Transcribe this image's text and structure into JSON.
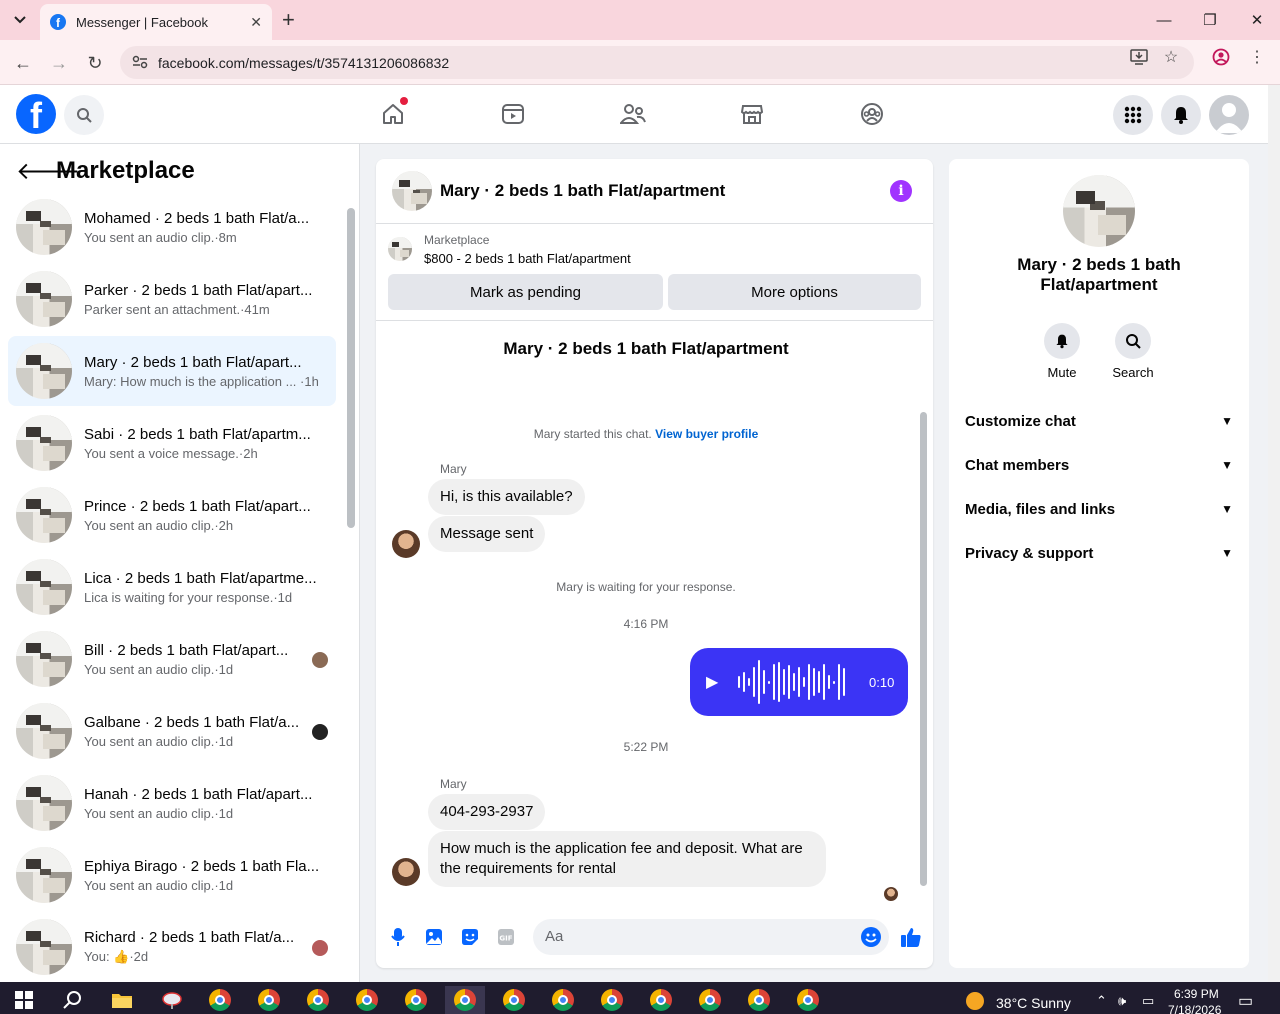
{
  "browser": {
    "tab_title": "Messenger | Facebook",
    "url": "facebook.com/messages/t/3574131206086832"
  },
  "left": {
    "title": "Marketplace",
    "conversations": [
      {
        "name": "Mohamed · 2 beds 1 bath Flat/a...",
        "preview": "You sent an audio clip.·8m"
      },
      {
        "name": "Parker · 2 beds 1 bath Flat/apart...",
        "preview": "Parker sent an attachment.·41m"
      },
      {
        "name": "Mary · 2 beds 1 bath Flat/apart...",
        "preview": "Mary: How much is the application ... ·1h"
      },
      {
        "name": "Sabi · 2 beds 1 bath Flat/apartm...",
        "preview": "You sent a voice message.·2h"
      },
      {
        "name": "Prince · 2 beds 1 bath Flat/apart...",
        "preview": "You sent an audio clip.·2h"
      },
      {
        "name": "Lica · 2 beds 1 bath Flat/apartme...",
        "preview": "Lica is waiting for your response.·1d"
      },
      {
        "name": "Bill · 2 beds 1 bath Flat/apart...",
        "preview": "You sent an audio clip.·1d"
      },
      {
        "name": "Galbane · 2 beds 1 bath Flat/a...",
        "preview": "You sent an audio clip.·1d"
      },
      {
        "name": "Hanah · 2 beds 1 bath Flat/apart...",
        "preview": "You sent an audio clip.·1d"
      },
      {
        "name": "Ephiya Birago · 2 beds 1 bath Fla...",
        "preview": "You sent an audio clip.·1d"
      },
      {
        "name": "Richard · 2 beds 1 bath Flat/a...",
        "preview": "You: 👍·2d"
      }
    ]
  },
  "chat": {
    "title": "Mary · 2 beds 1 bath Flat/apartment",
    "marketplace_label": "Marketplace",
    "listing": "$800 - 2 beds 1 bath Flat/apartment",
    "mark_pending": "Mark as pending",
    "more_options": "More options",
    "big_name": "Mary · 2 beds 1 bath Flat/apartment",
    "started_text": "Mary started this chat.",
    "view_profile": "View buyer profile",
    "sender": "Mary",
    "msg1": "Hi, is this available?",
    "msg2": "Message sent",
    "waiting": "Mary is waiting for your response.",
    "time1": "4:16 PM",
    "audio_duration": "0:10",
    "time2": "5:22 PM",
    "msg3": "404-293-2937",
    "msg4": "How much is the application fee and deposit. What are the requirements for rental",
    "input_placeholder": "Aa"
  },
  "right": {
    "name": "Mary · 2 beds 1 bath Flat/apartment",
    "mute": "Mute",
    "search": "Search",
    "sections": [
      "Customize chat",
      "Chat members",
      "Media, files and links",
      "Privacy & support"
    ]
  },
  "taskbar": {
    "weather": "38°C  Sunny",
    "time": "6:39 PM",
    "date": "7/18/2026"
  }
}
